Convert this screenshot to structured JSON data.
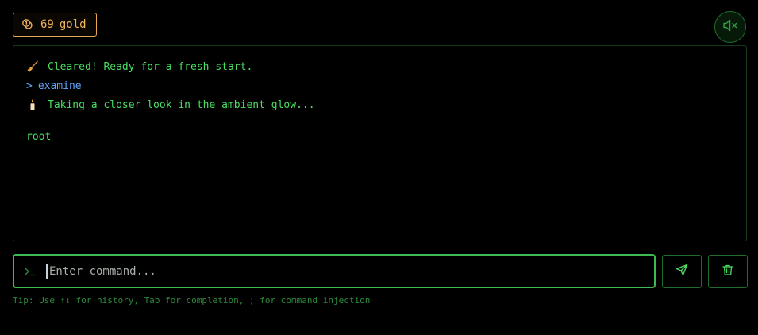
{
  "header": {
    "gold_amount": "69",
    "gold_label": "gold"
  },
  "terminal": {
    "lines": [
      {
        "icon": "broom-icon",
        "text": "Cleared! Ready for a fresh start."
      },
      {
        "prompt": ">",
        "text": "examine"
      },
      {
        "icon": "candle-icon",
        "text": "Taking a closer look in the ambient glow..."
      },
      {
        "text": "root"
      }
    ]
  },
  "input": {
    "placeholder": "Enter command...",
    "value": ""
  },
  "tip": "Tip: Use ↑↓ for history, Tab for completion, ; for command injection",
  "colors": {
    "gold": "#f0b35a",
    "terminal_text": "#4ade62",
    "command_text": "#60a5fa",
    "accent_border": "#3fb950"
  },
  "icons": [
    "coins-icon",
    "mute-icon",
    "broom-icon",
    "candle-icon",
    "terminal-prompt-icon",
    "send-icon",
    "trash-icon"
  ]
}
